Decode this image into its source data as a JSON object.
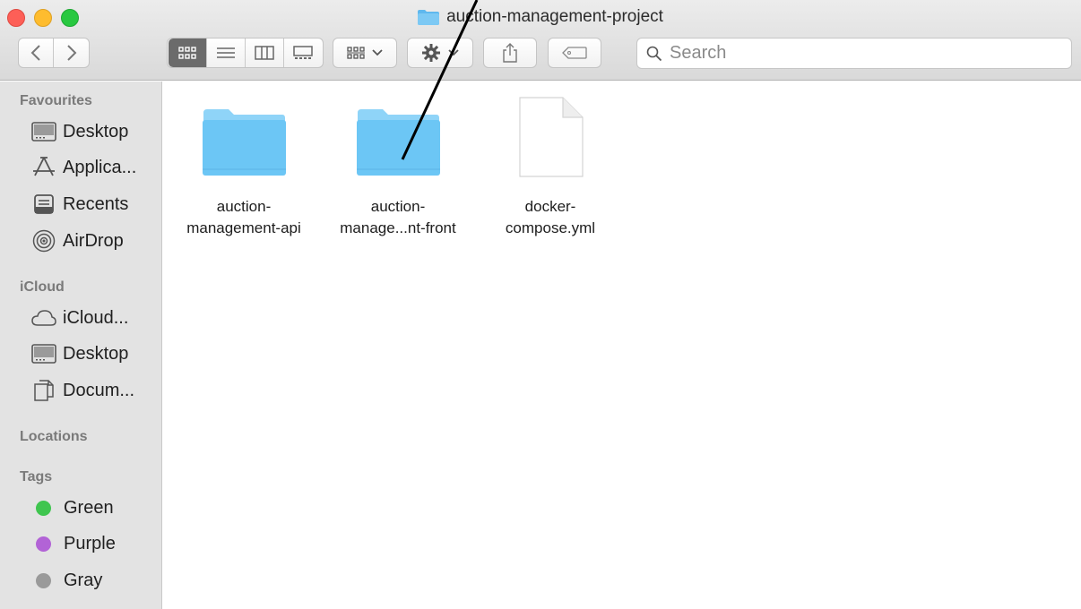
{
  "window": {
    "title": "auction-management-project"
  },
  "toolbar": {
    "back_icon": "chevron-left-icon",
    "forward_icon": "chevron-right-icon",
    "view_modes": [
      "icon-view",
      "list-view",
      "column-view",
      "gallery-view"
    ],
    "active_view": "icon-view",
    "group_icon": "group-by-icon",
    "action_icon": "gear-icon",
    "share_icon": "share-icon",
    "tag_icon": "tag-icon",
    "search_placeholder": "Search",
    "search_value": ""
  },
  "sidebar": {
    "favourites_heading": "Favourites",
    "favourites": [
      {
        "label": "Desktop",
        "icon": "desktop-icon"
      },
      {
        "label": "Applica...",
        "icon": "applications-icon"
      },
      {
        "label": "Recents",
        "icon": "recents-icon"
      },
      {
        "label": "AirDrop",
        "icon": "airdrop-icon"
      }
    ],
    "icloud_heading": "iCloud",
    "icloud": [
      {
        "label": "iCloud...",
        "icon": "cloud-icon"
      },
      {
        "label": "Desktop",
        "icon": "desktop-icon"
      },
      {
        "label": "Docum...",
        "icon": "documents-icon"
      }
    ],
    "locations_heading": "Locations",
    "tags_heading": "Tags",
    "tags": [
      {
        "label": "Green",
        "color": "#3fc54f"
      },
      {
        "label": "Purple",
        "color": "#b263d6"
      },
      {
        "label": "Gray",
        "color": "#9a9a9a"
      }
    ]
  },
  "files": [
    {
      "line1": "auction-",
      "line2": "management-api",
      "kind": "folder"
    },
    {
      "line1": "auction-",
      "line2": "manage...nt-front",
      "kind": "folder"
    },
    {
      "line1": "docker-",
      "line2": "compose.yml",
      "kind": "document"
    }
  ],
  "colors": {
    "folder_body": "#6cc6f5",
    "folder_tab": "#8fd4f8",
    "sidebar_bg": "#e3e3e3"
  }
}
